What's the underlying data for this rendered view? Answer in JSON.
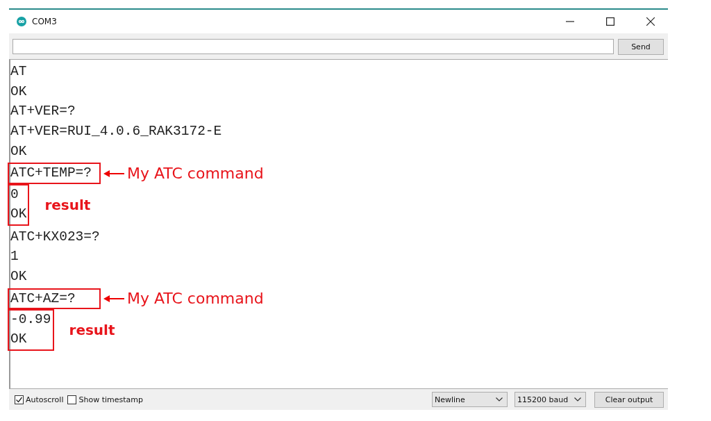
{
  "window": {
    "title": "COM3"
  },
  "send_button": "Send",
  "output": [
    {
      "kind": "plain",
      "lines": [
        "AT",
        "OK",
        "AT+VER=?",
        "AT+VER=RUI_4.0.6_RAK3172-E",
        "OK"
      ]
    },
    {
      "kind": "command",
      "lines": [
        "ATC+TEMP=?"
      ],
      "note": "My ATC command"
    },
    {
      "kind": "result",
      "lines": [
        "0",
        "OK"
      ],
      "note": "result"
    },
    {
      "kind": "plain",
      "lines": [
        "ATC+KX023=?",
        "1",
        "OK"
      ]
    },
    {
      "kind": "command",
      "lines": [
        "ATC+AZ=?"
      ],
      "note": "My ATC command"
    },
    {
      "kind": "result",
      "lines": [
        "-0.99",
        "OK"
      ],
      "note": "result"
    }
  ],
  "status_bar": {
    "checkboxes": [
      {
        "label": "Autoscroll",
        "checked": true
      },
      {
        "label": "Show timestamp",
        "checked": false
      }
    ],
    "dropdowns": [
      {
        "value": "Newline"
      },
      {
        "value": "115200 baud"
      }
    ],
    "clear_button": "Clear output"
  }
}
